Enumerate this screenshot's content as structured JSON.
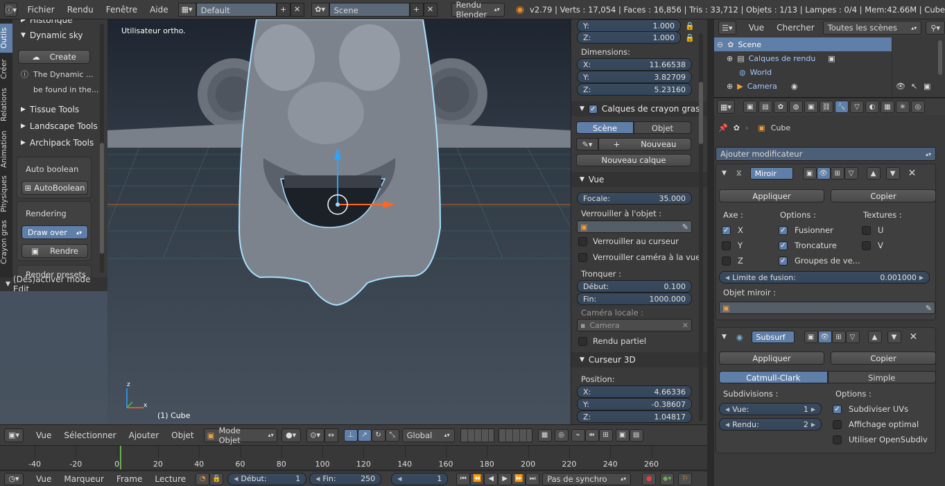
{
  "topbar": {
    "menus": [
      "Fichier",
      "Rendu",
      "Fenêtre",
      "Aide"
    ],
    "layout": "Default",
    "scene": "Scene",
    "engine": "Rendu Blender",
    "stats": "v2.79 | Verts : 17,054 | Faces : 16,856 | Tris : 33,712 | Objets : 1/13 | Lampes : 0/4 | Mem:42.66M | Cube"
  },
  "toolshelf": {
    "tabs": [
      "Outils",
      "Créer",
      "Relations",
      "Animation",
      "Physiques",
      "Crayon gras"
    ],
    "historique": "Historique",
    "dynamic_sky": "Dynamic sky",
    "create": "Create",
    "info1": "The Dynamic ...",
    "info2": "be found in the...",
    "tissue": "Tissue Tools",
    "landscape": "Landscape Tools",
    "archipack": "Archipack Tools",
    "auto_boolean_label": "Auto boolean",
    "auto_boolean_btn": "AutoBoolean",
    "rendering": "Rendering",
    "draw_over": "Draw over",
    "rendre": "Rendre",
    "render_presets": "Render presets",
    "edit_toggle": "(Dés)activer mode Edit"
  },
  "viewport": {
    "view_name": "Utilisateur ortho.",
    "object_label": "(1) Cube",
    "axis_z": "z",
    "axis_x": "x"
  },
  "npanel": {
    "y_label": "Y:",
    "y_val": "1.000",
    "z_label": "Z:",
    "z_val": "1.000",
    "dimensions": "Dimensions:",
    "dim_x": "11.66538",
    "dim_y": "3.82709",
    "dim_z": "5.23160",
    "x_label": "X:",
    "gp_title": "Calques de crayon gras",
    "scene_tab": "Scène",
    "objet_tab": "Objet",
    "nouveau": "Nouveau",
    "nouveau_calque": "Nouveau calque",
    "vue_title": "Vue",
    "focale": "Focale:",
    "focale_val": "35.000",
    "lock_obj": "Verrouiller à l'objet :",
    "lock_cursor": "Verrouiller au curseur",
    "lock_cam": "Verrouiller caméra à la vue",
    "tronquer": "Tronquer :",
    "debut": "Début:",
    "debut_val": "0.100",
    "fin": "Fin:",
    "fin_val": "1000.000",
    "cam_locale": "Caméra locale :",
    "camera": "Camera",
    "rendu_partiel": "Rendu partiel",
    "curseur_title": "Curseur 3D",
    "position": "Position:",
    "cur_x": "4.66336",
    "cur_y": "-0.38607",
    "cur_z": "1.04817"
  },
  "outliner": {
    "menus": [
      "Vue",
      "Chercher"
    ],
    "filter": "Toutes les scènes",
    "items": [
      "Scene",
      "Calques de rendu",
      "World",
      "Camera"
    ]
  },
  "properties": {
    "breadcrumb": "Cube",
    "add_mod": "Ajouter modificateur",
    "mirror_name": "Miroir",
    "appliquer": "Appliquer",
    "copier": "Copier",
    "axe": "Axe :",
    "options": "Options :",
    "textures": "Textures :",
    "x": "X",
    "y": "Y",
    "z": "Z",
    "fusionner": "Fusionner",
    "troncature": "Troncature",
    "groupes": "Groupes de ve...",
    "u": "U",
    "v": "V",
    "limite": "Limite de fusion:",
    "limite_val": "0.001000",
    "objet_miroir": "Objet miroir :",
    "subsurf_name": "Subsurf",
    "catmull": "Catmull-Clark",
    "simple": "Simple",
    "subdivisions": "Subdivisions :",
    "vue_label": "Vue:",
    "vue_val": "1",
    "rendu_label": "Rendu:",
    "rendu_val": "2",
    "opt_label": "Options :",
    "subdiv_uv": "Subdiviser UVs",
    "affichage": "Affichage optimal",
    "opensubdiv": "Utiliser OpenSubdiv"
  },
  "view3d_header": {
    "menus": [
      "Vue",
      "Sélectionner",
      "Ajouter",
      "Objet"
    ],
    "mode": "Mode Objet",
    "orientation": "Global"
  },
  "timeline": {
    "ticks": [
      "-40",
      "-20",
      "0",
      "20",
      "40",
      "60",
      "80",
      "100",
      "120",
      "140",
      "160",
      "180",
      "200",
      "220",
      "240",
      "260"
    ],
    "menus": [
      "Vue",
      "Marqueur",
      "Frame",
      "Lecture"
    ],
    "start_label": "Début:",
    "start_val": "1",
    "end_label": "Fin:",
    "end_val": "250",
    "current": "1",
    "sync": "Pas de synchro"
  },
  "colors": {
    "accent": "#5f7ea8",
    "viewport_top": "#3f4a57",
    "viewport_bottom": "#47525e",
    "outline": "#9fd8ff"
  }
}
